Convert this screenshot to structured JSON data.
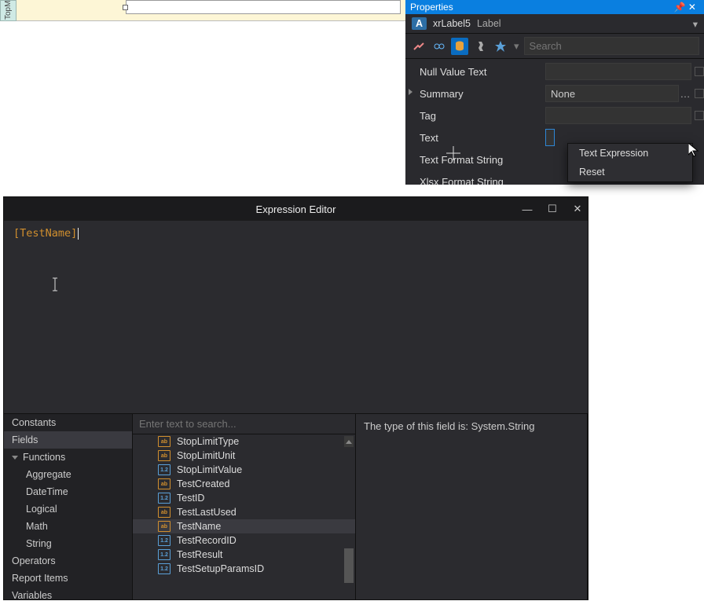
{
  "designer": {
    "band_label": "TopM"
  },
  "properties": {
    "panel_title": "Properties",
    "sel_name": "xrLabel5",
    "sel_type": "Label",
    "search_placeholder": "Search",
    "rows": {
      "null_value_text": "Null Value Text",
      "summary": "Summary",
      "summary_value": "None",
      "tag": "Tag",
      "text": "Text",
      "text_format_string": "Text Format String",
      "xlsx_format_string": "Xlsx Format String"
    },
    "context_menu": {
      "text_expression": "Text Expression",
      "reset": "Reset"
    }
  },
  "expr": {
    "title": "Expression Editor",
    "code": "[TestName]",
    "search_placeholder": "Enter text to search...",
    "categories": {
      "constants": "Constants",
      "fields": "Fields",
      "functions": "Functions",
      "aggregate": "Aggregate",
      "datetime": "DateTime",
      "logical": "Logical",
      "math": "Math",
      "string": "String",
      "operators": "Operators",
      "report_items": "Report Items",
      "variables": "Variables"
    },
    "fields": [
      {
        "name": "StopLimitType",
        "t": "ab"
      },
      {
        "name": "StopLimitUnit",
        "t": "ab"
      },
      {
        "name": "StopLimitValue",
        "t": "12"
      },
      {
        "name": "TestCreated",
        "t": "ab"
      },
      {
        "name": "TestID",
        "t": "12"
      },
      {
        "name": "TestLastUsed",
        "t": "ab"
      },
      {
        "name": "TestName",
        "t": "ab"
      },
      {
        "name": "TestRecordID",
        "t": "12"
      },
      {
        "name": "TestResult",
        "t": "12"
      },
      {
        "name": "TestSetupParamsID",
        "t": "12"
      }
    ],
    "desc": "The type of this field is: System.String"
  }
}
